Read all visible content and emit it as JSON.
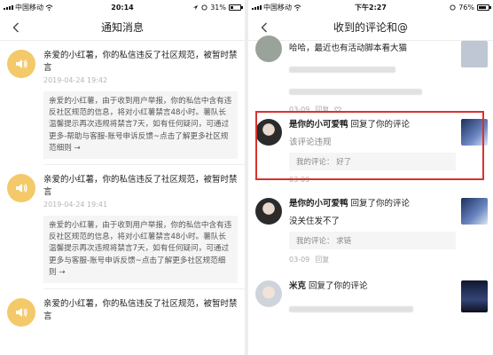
{
  "left": {
    "status": {
      "carrier": "中国移动",
      "time": "20:14",
      "battery_text": "31%",
      "battery_level": 0.31
    },
    "title": "通知消息",
    "notices": [
      {
        "title": "亲爱的小红薯，你的私信违反了社区规范，被暂时禁言",
        "time": "2019-04-24 19:42",
        "detail": "亲爱的小红薯，由于收到用户举报，你的私信中含有违反社区规范的信息，将对小红薯禁言48小时。薯队长温馨提示再次违规将禁言7天，如有任何疑问，可通过更多-帮助与客服-账号申诉反馈~点击了解更多社区规范细则 →"
      },
      {
        "title": "亲爱的小红薯，你的私信违反了社区规范，被暂时禁言",
        "time": "2019-04-24 19:41",
        "detail": "亲爱的小红薯，由于收到用户举报，你的私信中含有违反社区规范的信息，将对小红薯禁言48小时。薯队长温馨提示再次违规将禁言7天，如有任何疑问，可通过更多与客服-账号申诉反馈~点击了解更多社区规范细则 →"
      },
      {
        "title": "亲爱的小红薯，你的私信违反了社区规范，被暂时禁言",
        "time": "",
        "detail": ""
      }
    ]
  },
  "right": {
    "status": {
      "carrier": "中国移动",
      "time": "下午2:27",
      "battery_text": "76%",
      "battery_level": 0.76
    },
    "title": "收到的评论和@",
    "top_item": {
      "text": "哈哈，最近也有活动脚本看大猫",
      "date": "03-09",
      "reply_label": "回复",
      "like_icon": "heart-outline"
    },
    "comments": [
      {
        "name": "是你的小可爱鸭",
        "action": "回复了你的评论",
        "text": "该评论违规",
        "my_comment_label": "我的评论：",
        "my_comment": "好了",
        "date": "03-09"
      },
      {
        "name": "是你的小可爱鸭",
        "action": "回复了你的评论",
        "text": "没关住发不了",
        "my_comment_label": "我的评论：",
        "my_comment": "求链",
        "date": "03-09",
        "reply_label": "回复"
      },
      {
        "name": "米克",
        "action": "回复了你的评论",
        "text": "",
        "date": ""
      }
    ]
  },
  "colors": {
    "highlight": "#d8332f",
    "notice_avatar": "#f3c96a"
  }
}
